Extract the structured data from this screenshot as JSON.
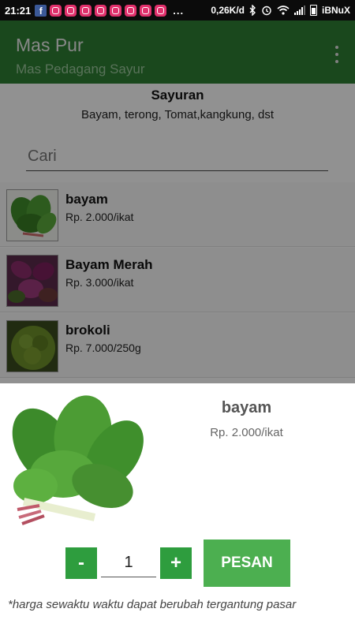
{
  "status_bar": {
    "time": "21:21",
    "net_speed": "0,26K/d",
    "carrier": "iBNuX"
  },
  "app_bar": {
    "title": "Mas Pur",
    "subtitle": "Mas Pedagang Sayur"
  },
  "category": {
    "title": "Sayuran",
    "description": "Bayam, terong, Tomat,kangkung, dst"
  },
  "search": {
    "placeholder": "Cari"
  },
  "items": [
    {
      "name": "bayam",
      "price": "Rp. 2.000/ikat"
    },
    {
      "name": "Bayam Merah",
      "price": "Rp. 3.000/ikat"
    },
    {
      "name": "brokoli",
      "price": "Rp. 7.000/250g"
    }
  ],
  "sheet": {
    "product_name": "bayam",
    "product_price": "Rp. 2.000/ikat",
    "minus_label": "-",
    "plus_label": "+",
    "quantity": "1",
    "order_label": "PESAN",
    "note": "*harga sewaktu waktu dapat berubah tergantung pasar"
  },
  "colors": {
    "primary": "#2e7d32",
    "button": "#2e9d3e",
    "order_button": "#4caf50"
  }
}
